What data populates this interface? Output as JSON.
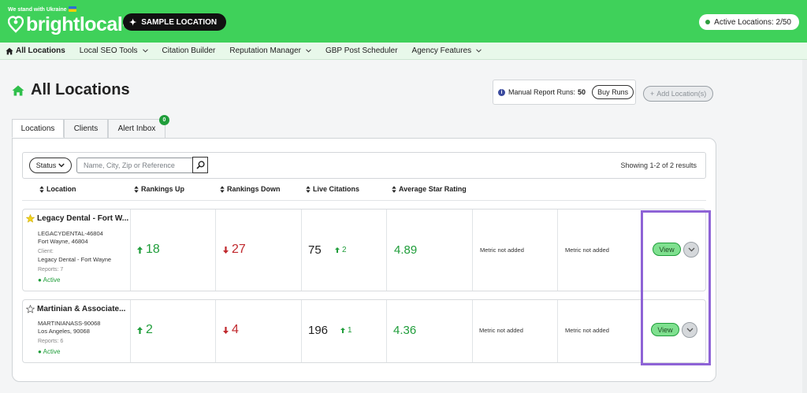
{
  "header": {
    "ukraine_text": "We stand with Ukraine",
    "logo_text": "brightlocal",
    "sample_location_label": "SAMPLE LOCATION",
    "active_locations": "Active Locations: 2/50"
  },
  "nav": {
    "items": [
      {
        "label": "All Locations"
      },
      {
        "label": "Local SEO Tools"
      },
      {
        "label": "Citation Builder"
      },
      {
        "label": "Reputation Manager"
      },
      {
        "label": "GBP Post Scheduler"
      },
      {
        "label": "Agency Features"
      }
    ]
  },
  "page": {
    "title": "All Locations",
    "manual_runs_label": "Manual Report Runs:",
    "manual_runs_value": "50",
    "buy_runs_label": "Buy Runs",
    "add_location_label": "Add Location(s)"
  },
  "tabs": [
    {
      "label": "Locations"
    },
    {
      "label": "Clients"
    },
    {
      "label": "Alert Inbox"
    }
  ],
  "alert_badge": "0",
  "filters": {
    "status_label": "Status",
    "search_placeholder": "Name, City, Zip or Reference",
    "showing_text": "Showing 1-2 of 2 results"
  },
  "columns": [
    "Location",
    "Rankings Up",
    "Rankings Down",
    "Live Citations",
    "Average Star Rating"
  ],
  "rows": [
    {
      "name": "Legacy Dental - Fort W...",
      "reference": "LEGACYDENTAL-46804",
      "city_zip": "Fort Wayne, 46804",
      "client_label": "Client:",
      "client": "Legacy Dental - Fort Wayne",
      "reports": "Reports: 7",
      "status": "Active",
      "rankings_up": "18",
      "rankings_down": "27",
      "citations": "75",
      "citations_change": "2",
      "rating": "4.89",
      "metric1": "Metric not added",
      "metric2": "Metric not added",
      "view_label": "View",
      "starred": true
    },
    {
      "name": "Martinian & Associate...",
      "reference": "MARTINIANASS-90068",
      "city_zip": "Los Angeles, 90068",
      "reports": "Reports: 6",
      "status": "Active",
      "rankings_up": "2",
      "rankings_down": "4",
      "citations": "196",
      "citations_change": "1",
      "rating": "4.36",
      "metric1": "Metric not added",
      "metric2": "Metric not added",
      "view_label": "View",
      "starred": false
    }
  ],
  "colors": {
    "brand_green": "#3fd15a",
    "up_green": "#1f9d3a",
    "down_red": "#c0282d",
    "highlight_purple": "#8e63d6"
  }
}
